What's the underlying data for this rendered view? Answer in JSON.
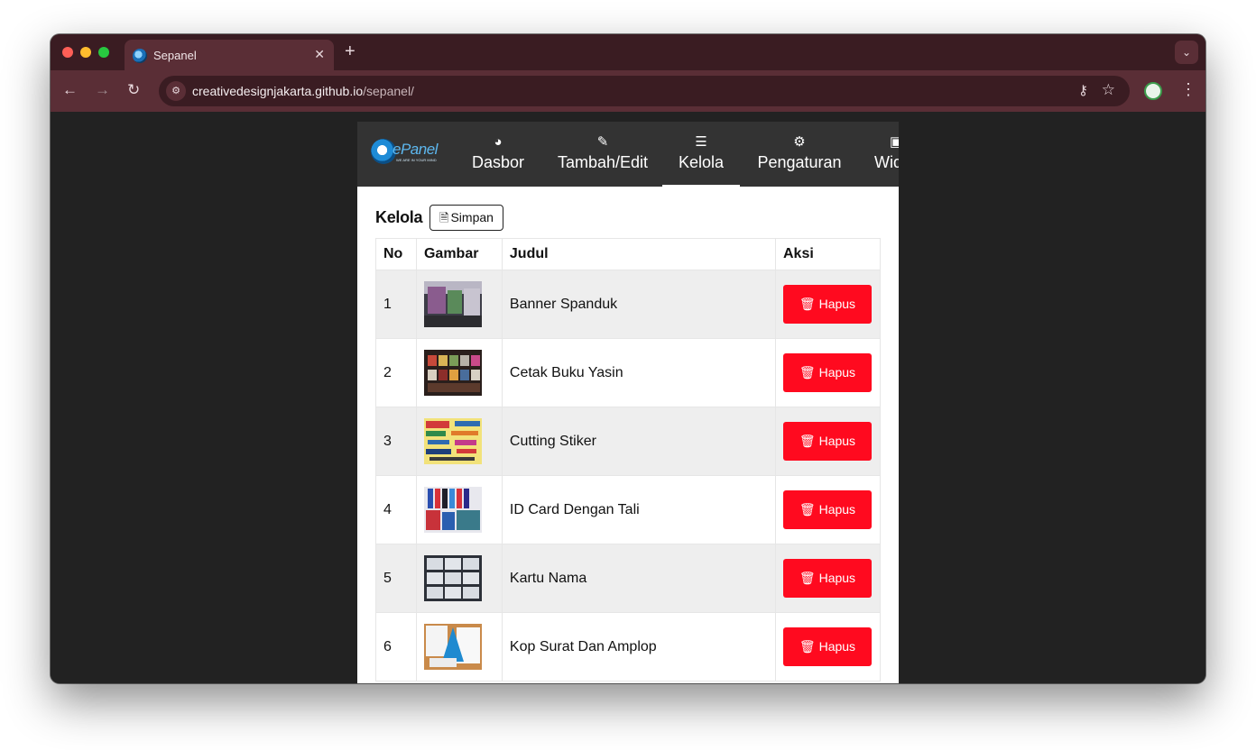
{
  "browser": {
    "tab_title": "Sepanel",
    "tab_close": "✕",
    "new_tab": "+",
    "url_domain": "creativedesignjakarta.github.io",
    "url_path": "/sepanel/",
    "back": "←",
    "forward": "→",
    "reload": "↻",
    "menu": "⋮",
    "tab_search": "⌄"
  },
  "nav": {
    "logo_text": "ePanel",
    "logo_tagline": "WE ARE IN YOUR MIND",
    "items": [
      {
        "label": "Dasbor",
        "icon": "tachometer-icon",
        "glyph": "◕"
      },
      {
        "label": "Tambah/Edit",
        "icon": "edit-icon",
        "glyph": "✎"
      },
      {
        "label": "Kelola",
        "icon": "list-icon",
        "glyph": "☰",
        "active": true
      },
      {
        "label": "Pengaturan",
        "icon": "gear-icon",
        "glyph": "⚙"
      },
      {
        "label": "Widget",
        "icon": "widget-icon",
        "glyph": "▣"
      }
    ]
  },
  "main": {
    "heading": "Kelola",
    "save_label": "Simpan",
    "save_icon": "🗎",
    "columns": [
      "No",
      "Gambar",
      "Judul",
      "Aksi"
    ],
    "delete_label": "Hapus",
    "delete_icon": "🗑",
    "rows": [
      {
        "no": "1",
        "title": "Banner Spanduk",
        "thumb": "banner-spanduk-thumbnail"
      },
      {
        "no": "2",
        "title": "Cetak Buku Yasin",
        "thumb": "buku-yasin-thumbnail"
      },
      {
        "no": "3",
        "title": "Cutting Stiker",
        "thumb": "cutting-stiker-thumbnail"
      },
      {
        "no": "4",
        "title": "ID Card Dengan Tali",
        "thumb": "id-card-thumbnail"
      },
      {
        "no": "5",
        "title": "Kartu Nama",
        "thumb": "kartu-nama-thumbnail"
      },
      {
        "no": "6",
        "title": "Kop Surat Dan Amplop",
        "thumb": "kop-surat-thumbnail"
      }
    ]
  },
  "colors": {
    "nav_bg": "#333333",
    "delete_button": "#ff0a1f",
    "row_stripe": "#eeeeee",
    "browser_frame": "#5a2e36"
  }
}
